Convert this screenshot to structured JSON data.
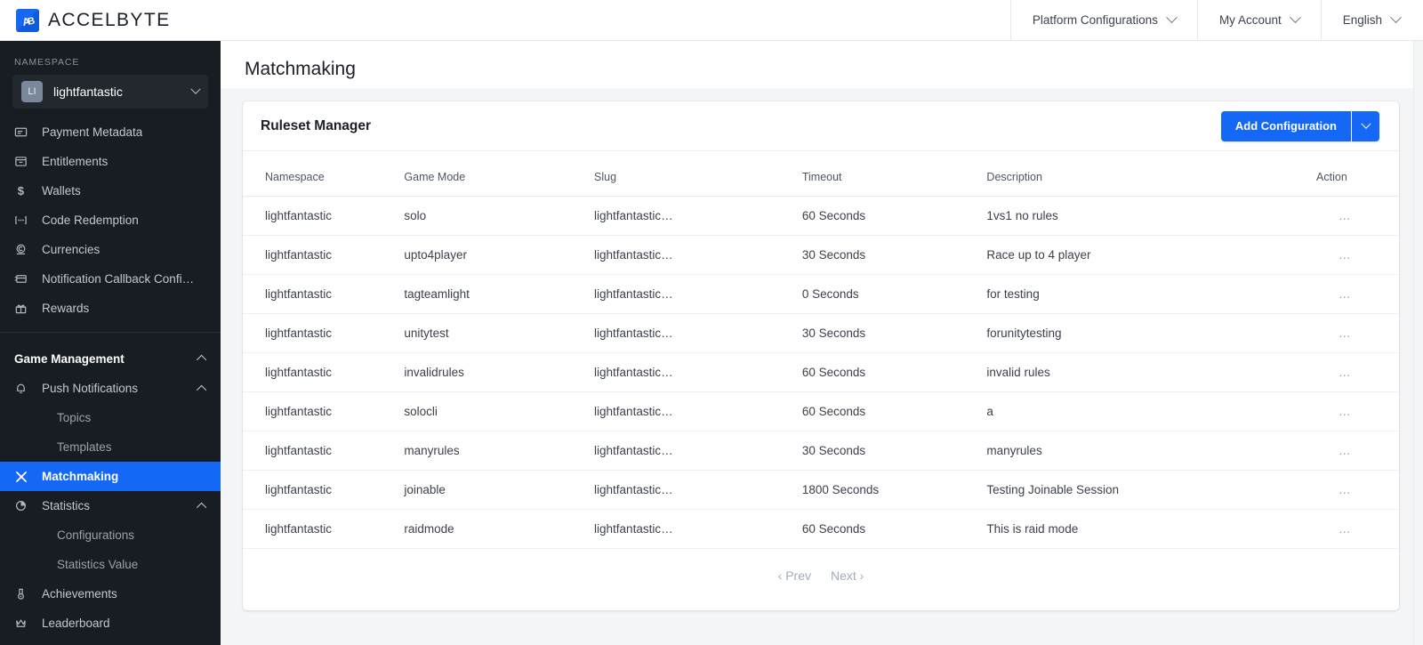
{
  "brand": {
    "name": "ACCELBYTE",
    "logo_icon": "accelbyte-logo-icon",
    "accent_color": "#1468f5"
  },
  "topnav": {
    "items": [
      {
        "label": "Platform Configurations",
        "icon": "chevron-down-icon"
      },
      {
        "label": "My Account",
        "icon": "chevron-down-icon"
      },
      {
        "label": "English",
        "icon": "chevron-down-icon"
      }
    ]
  },
  "sidebar": {
    "namespace_label": "NAMESPACE",
    "namespace": {
      "avatar_initials": "LI",
      "name": "lightfantastic",
      "icon": "chevron-down-icon"
    },
    "items": [
      {
        "label": "Payment Metadata",
        "icon": "payment-metadata-icon",
        "type": "item",
        "active": false
      },
      {
        "label": "Entitlements",
        "icon": "entitlements-icon",
        "type": "item",
        "active": false
      },
      {
        "label": "Wallets",
        "icon": "wallet-dollar-icon",
        "type": "item",
        "active": false
      },
      {
        "label": "Code Redemption",
        "icon": "code-redemption-icon",
        "type": "item",
        "active": false
      },
      {
        "label": "Currencies",
        "icon": "currencies-icon",
        "type": "item",
        "active": false
      },
      {
        "label": "Notification Callback Configur...",
        "icon": "notification-callback-icon",
        "type": "item",
        "active": false
      },
      {
        "label": "Rewards",
        "icon": "gift-icon",
        "type": "item",
        "active": false
      },
      {
        "label": "Game Management",
        "icon": "caret-up-icon",
        "type": "section",
        "active": false
      },
      {
        "label": "Push Notifications",
        "icon": "bell-icon",
        "type": "item-expandable",
        "active": false
      },
      {
        "label": "Topics",
        "icon": "",
        "type": "child",
        "active": false
      },
      {
        "label": "Templates",
        "icon": "",
        "type": "child",
        "active": false
      },
      {
        "label": "Matchmaking",
        "icon": "matchmaking-swords-icon",
        "type": "item",
        "active": true
      },
      {
        "label": "Statistics",
        "icon": "statistics-pie-icon",
        "type": "item-expandable",
        "active": false
      },
      {
        "label": "Configurations",
        "icon": "",
        "type": "child",
        "active": false
      },
      {
        "label": "Statistics Value",
        "icon": "",
        "type": "child",
        "active": false
      },
      {
        "label": "Achievements",
        "icon": "achievements-medal-icon",
        "type": "item",
        "active": false
      },
      {
        "label": "Leaderboard",
        "icon": "leaderboard-crown-icon",
        "type": "item",
        "active": false
      }
    ]
  },
  "page": {
    "title": "Matchmaking"
  },
  "card": {
    "title": "Ruleset Manager",
    "add_button_label": "Add Configuration",
    "add_button_dropdown_icon": "chevron-down-icon"
  },
  "table": {
    "columns": [
      "Namespace",
      "Game Mode",
      "Slug",
      "Timeout",
      "Description",
      "Action"
    ],
    "rows": [
      {
        "namespace": "lightfantastic",
        "game_mode": "solo",
        "slug": "lightfantastic…",
        "timeout": "60 Seconds",
        "description": "1vs1 no rules",
        "action": "…"
      },
      {
        "namespace": "lightfantastic",
        "game_mode": "upto4player",
        "slug": "lightfantastic…",
        "timeout": "30 Seconds",
        "description": "Race up to 4 player",
        "action": "…"
      },
      {
        "namespace": "lightfantastic",
        "game_mode": "tagteamlight",
        "slug": "lightfantastic…",
        "timeout": "0 Seconds",
        "description": "for testing",
        "action": "…"
      },
      {
        "namespace": "lightfantastic",
        "game_mode": "unitytest",
        "slug": "lightfantastic…",
        "timeout": "30 Seconds",
        "description": "forunitytesting",
        "action": "…"
      },
      {
        "namespace": "lightfantastic",
        "game_mode": "invalidrules",
        "slug": "lightfantastic…",
        "timeout": "60 Seconds",
        "description": "invalid rules",
        "action": "…"
      },
      {
        "namespace": "lightfantastic",
        "game_mode": "solocli",
        "slug": "lightfantastic…",
        "timeout": "60 Seconds",
        "description": "a",
        "action": "…"
      },
      {
        "namespace": "lightfantastic",
        "game_mode": "manyrules",
        "slug": "lightfantastic…",
        "timeout": "30 Seconds",
        "description": "manyrules",
        "action": "…"
      },
      {
        "namespace": "lightfantastic",
        "game_mode": "joinable",
        "slug": "lightfantastic…",
        "timeout": "1800 Seconds",
        "description": "Testing Joinable Session",
        "action": "…"
      },
      {
        "namespace": "lightfantastic",
        "game_mode": "raidmode",
        "slug": "lightfantastic…",
        "timeout": "60 Seconds",
        "description": "This is raid mode",
        "action": "…"
      }
    ]
  },
  "pagination": {
    "prev_label": "‹ Prev",
    "next_label": "Next ›"
  }
}
